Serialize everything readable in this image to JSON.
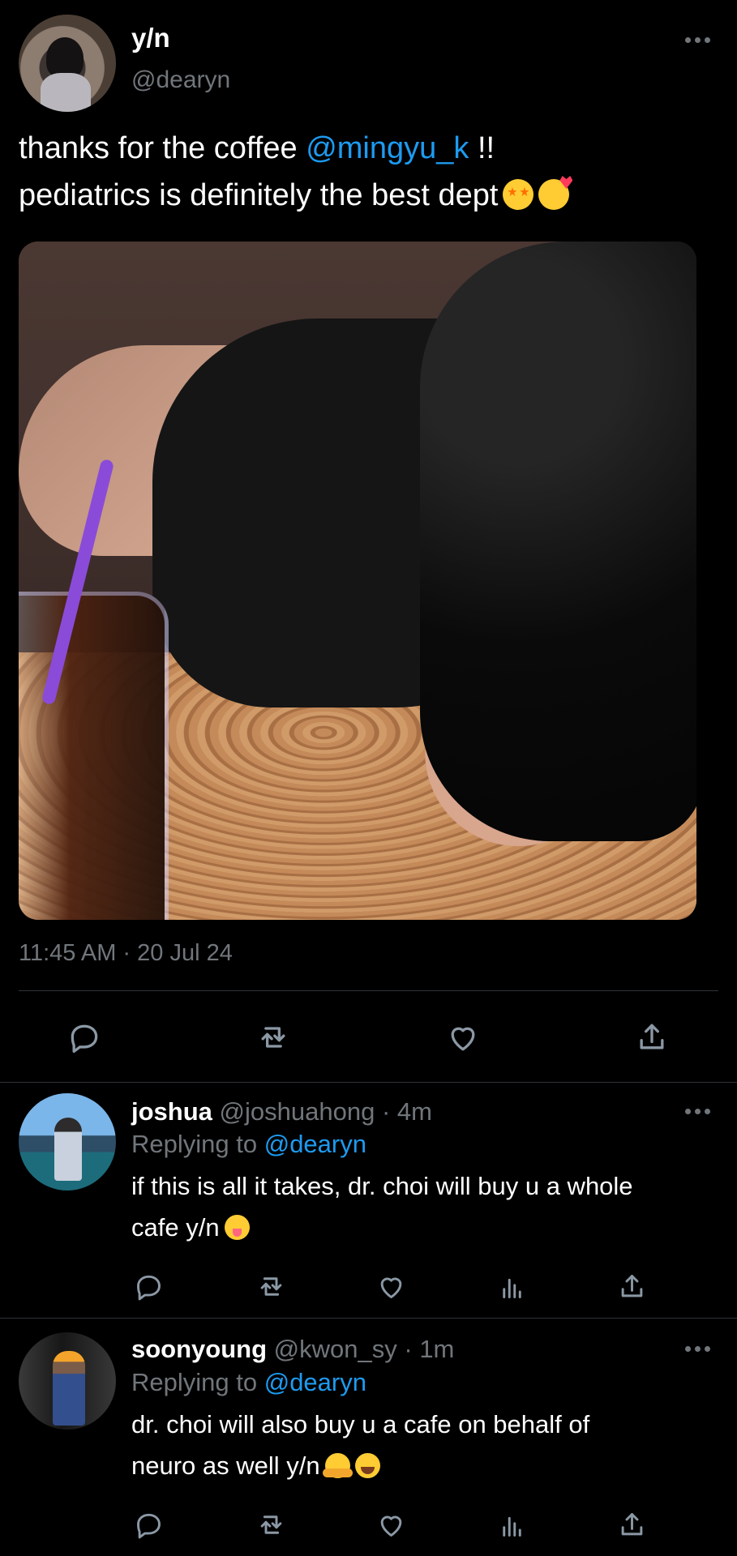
{
  "tweet": {
    "display_name": "y/n",
    "handle": "@dearyn",
    "text_part1": "thanks for the coffee ",
    "mention": "@mingyu_k",
    "text_part2": " !!",
    "text_line2": "pediatrics is definitely the best dept",
    "timestamp": "11:45 AM · 20 Jul 24",
    "icons": {
      "more": "more-options-icon",
      "reply": "reply-icon",
      "retweet": "retweet-icon",
      "like": "heart-icon",
      "share": "share-icon"
    }
  },
  "replies": [
    {
      "name": "joshua",
      "handle": "@joshuahong",
      "time": " · 4m",
      "replying_label": "Replying to ",
      "replying_handle": "@dearyn",
      "line1": "if this is all it takes, dr. choi will buy u a whole",
      "line2": "cafe y/n"
    },
    {
      "name": "soonyoung",
      "handle": "@kwon_sy",
      "time": " · 1m",
      "replying_label": "Replying to ",
      "replying_handle": "@dearyn",
      "line1": "dr. choi will also buy u a cafe on behalf of",
      "line2": "neuro as well y/n"
    }
  ],
  "colors": {
    "background": "#000000",
    "text": "#ffffff",
    "secondary_text": "#71767b",
    "link": "#1d9bf0",
    "divider": "#2f3336"
  }
}
